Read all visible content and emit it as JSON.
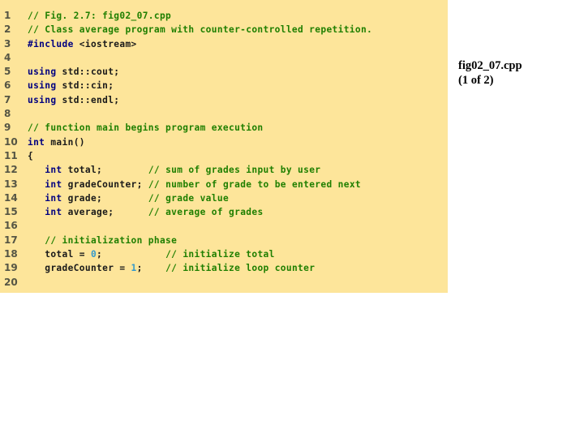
{
  "colors": {
    "panel_background": "#fde59a",
    "keyword": "#000080",
    "identifier": "#1a1a1a",
    "comment": "#1f7f00",
    "number": "#3399cc",
    "line_number": "#555544"
  },
  "code": {
    "lines": [
      {
        "num": "1",
        "tokens": [
          {
            "t": "cm",
            "v": "// Fig. 2.7: fig02_07.cpp"
          }
        ]
      },
      {
        "num": "2",
        "tokens": [
          {
            "t": "cm",
            "v": "// Class average program with counter-controlled repetition."
          }
        ]
      },
      {
        "num": "3",
        "tokens": [
          {
            "t": "pre",
            "v": "#include"
          },
          {
            "t": "id",
            "v": " <iostream>"
          }
        ]
      },
      {
        "num": "4",
        "tokens": []
      },
      {
        "num": "5",
        "tokens": [
          {
            "t": "kw",
            "v": "using"
          },
          {
            "t": "id",
            "v": " std::cout;"
          }
        ]
      },
      {
        "num": "6",
        "tokens": [
          {
            "t": "kw",
            "v": "using"
          },
          {
            "t": "id",
            "v": " std::cin;"
          }
        ]
      },
      {
        "num": "7",
        "tokens": [
          {
            "t": "kw",
            "v": "using"
          },
          {
            "t": "id",
            "v": " std::endl;"
          }
        ]
      },
      {
        "num": "8",
        "tokens": []
      },
      {
        "num": "9",
        "tokens": [
          {
            "t": "cm",
            "v": "// function main begins program execution"
          }
        ]
      },
      {
        "num": "10",
        "tokens": [
          {
            "t": "kw",
            "v": "int"
          },
          {
            "t": "id",
            "v": " main()"
          }
        ]
      },
      {
        "num": "11",
        "tokens": [
          {
            "t": "id",
            "v": "{"
          }
        ]
      },
      {
        "num": "12",
        "tokens": [
          {
            "t": "id",
            "v": "   "
          },
          {
            "t": "kw",
            "v": "int"
          },
          {
            "t": "id",
            "v": " total;        "
          },
          {
            "t": "cm",
            "v": "// sum of grades input by user"
          }
        ]
      },
      {
        "num": "13",
        "tokens": [
          {
            "t": "id",
            "v": "   "
          },
          {
            "t": "kw",
            "v": "int"
          },
          {
            "t": "id",
            "v": " gradeCounter; "
          },
          {
            "t": "cm",
            "v": "// number of grade to be entered next"
          }
        ]
      },
      {
        "num": "14",
        "tokens": [
          {
            "t": "id",
            "v": "   "
          },
          {
            "t": "kw",
            "v": "int"
          },
          {
            "t": "id",
            "v": " grade;        "
          },
          {
            "t": "cm",
            "v": "// grade value"
          }
        ]
      },
      {
        "num": "15",
        "tokens": [
          {
            "t": "id",
            "v": "   "
          },
          {
            "t": "kw",
            "v": "int"
          },
          {
            "t": "id",
            "v": " average;      "
          },
          {
            "t": "cm",
            "v": "// average of grades"
          }
        ]
      },
      {
        "num": "16",
        "tokens": []
      },
      {
        "num": "17",
        "tokens": [
          {
            "t": "id",
            "v": "   "
          },
          {
            "t": "cm",
            "v": "// initialization phase"
          }
        ]
      },
      {
        "num": "18",
        "tokens": [
          {
            "t": "id",
            "v": "   total = "
          },
          {
            "t": "num",
            "v": "0"
          },
          {
            "t": "id",
            "v": ";           "
          },
          {
            "t": "cm",
            "v": "// initialize total"
          }
        ]
      },
      {
        "num": "19",
        "tokens": [
          {
            "t": "id",
            "v": "   gradeCounter = "
          },
          {
            "t": "num",
            "v": "1"
          },
          {
            "t": "id",
            "v": ";    "
          },
          {
            "t": "cm",
            "v": "// initialize loop counter"
          }
        ]
      },
      {
        "num": "20",
        "tokens": []
      }
    ]
  },
  "side_label": {
    "filename": "fig02_07.cpp",
    "page": "(1 of 2)"
  }
}
